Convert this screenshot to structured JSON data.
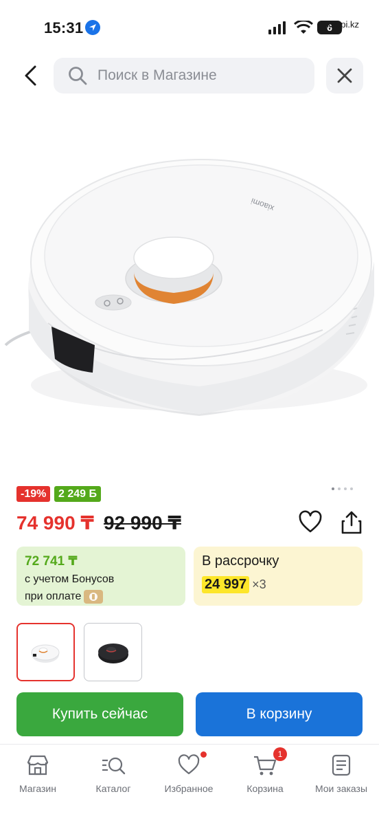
{
  "status_bar": {
    "time": "15:31",
    "battery": "6",
    "domain": "kaspi.kz"
  },
  "search": {
    "placeholder": "Поиск в Магазине"
  },
  "product": {
    "discount_badge": "-19%",
    "bonus_badge": "2 249 Б",
    "price_current": "74 990 ₸",
    "price_old": "92 990 ₸",
    "image_count": 4,
    "active_image": 1
  },
  "bonus_card": {
    "amount": "72 741 ₸",
    "line1": "с учетом Бонусов",
    "line2": "при оплате"
  },
  "installment_card": {
    "title": "В рассрочку",
    "monthly": "24 997",
    "months": "×3"
  },
  "variants": [
    {
      "name": "white",
      "selected": true
    },
    {
      "name": "black",
      "selected": false
    }
  ],
  "actions": {
    "buy_label": "Купить сейчас",
    "cart_label": "В корзину"
  },
  "tabs": [
    {
      "label": "Магазин",
      "icon": "store-icon"
    },
    {
      "label": "Каталог",
      "icon": "catalog-search-icon"
    },
    {
      "label": "Избранное",
      "icon": "heart-icon",
      "dot": true
    },
    {
      "label": "Корзина",
      "icon": "cart-icon",
      "badge": "1"
    },
    {
      "label": "Мои заказы",
      "icon": "orders-icon"
    }
  ],
  "colors": {
    "accent_red": "#e5322d",
    "accent_green": "#54a91b",
    "buy_button": "#3aa83e",
    "cart_button": "#1a73d9",
    "installment_highlight": "#fde62a"
  }
}
